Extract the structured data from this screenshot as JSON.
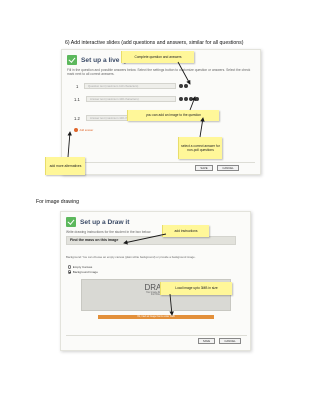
{
  "doc": {
    "step_heading": "6)   Add interactive slides (add questions and answers, similar for all questions)",
    "section_heading": "For image drawing"
  },
  "qa": {
    "title": "Set up a live Q&A",
    "instructions": "Fill in the question and possible answers below. Select the settings button to customize question or answers. Select the check mark next to all correct answers.",
    "rows": [
      {
        "num": "1",
        "placeholder": "Question text (maximum 110 characters)"
      },
      {
        "num": "1.1",
        "placeholder": "Answer text (maximum 100 characters)"
      },
      {
        "num": "1.2",
        "placeholder": "Answer text (maximum 100 characters)"
      }
    ],
    "add_label": "Add answer",
    "save_label": "SAVE",
    "cancel_label": "CANCEL",
    "notes": {
      "complete": "Complete question and answers",
      "image": "you can add an image to the question",
      "correct": "select a correct answer for non-poll questions",
      "alternatives": "add more alternatives"
    }
  },
  "draw": {
    "title": "Set up a Draw it",
    "instructions": "Write drawing instructions for the student in the box below.",
    "field_value": "Find the mass on this image",
    "background_text": "Background: You can choose an empty canvas (plain white background) or provide a background image.",
    "options": [
      "Empty Canvas",
      "Background Image"
    ],
    "drop_label": "DRAG",
    "drop_sub1": "Your image file here",
    "drop_sub2": "from Files",
    "warning": "Ok, tried an image that is under 3MB",
    "save_label": "SAVE",
    "cancel_label": "CANCEL",
    "notes": {
      "instructions": "add instructions",
      "upload": "Load image upto 3MB in size"
    }
  }
}
